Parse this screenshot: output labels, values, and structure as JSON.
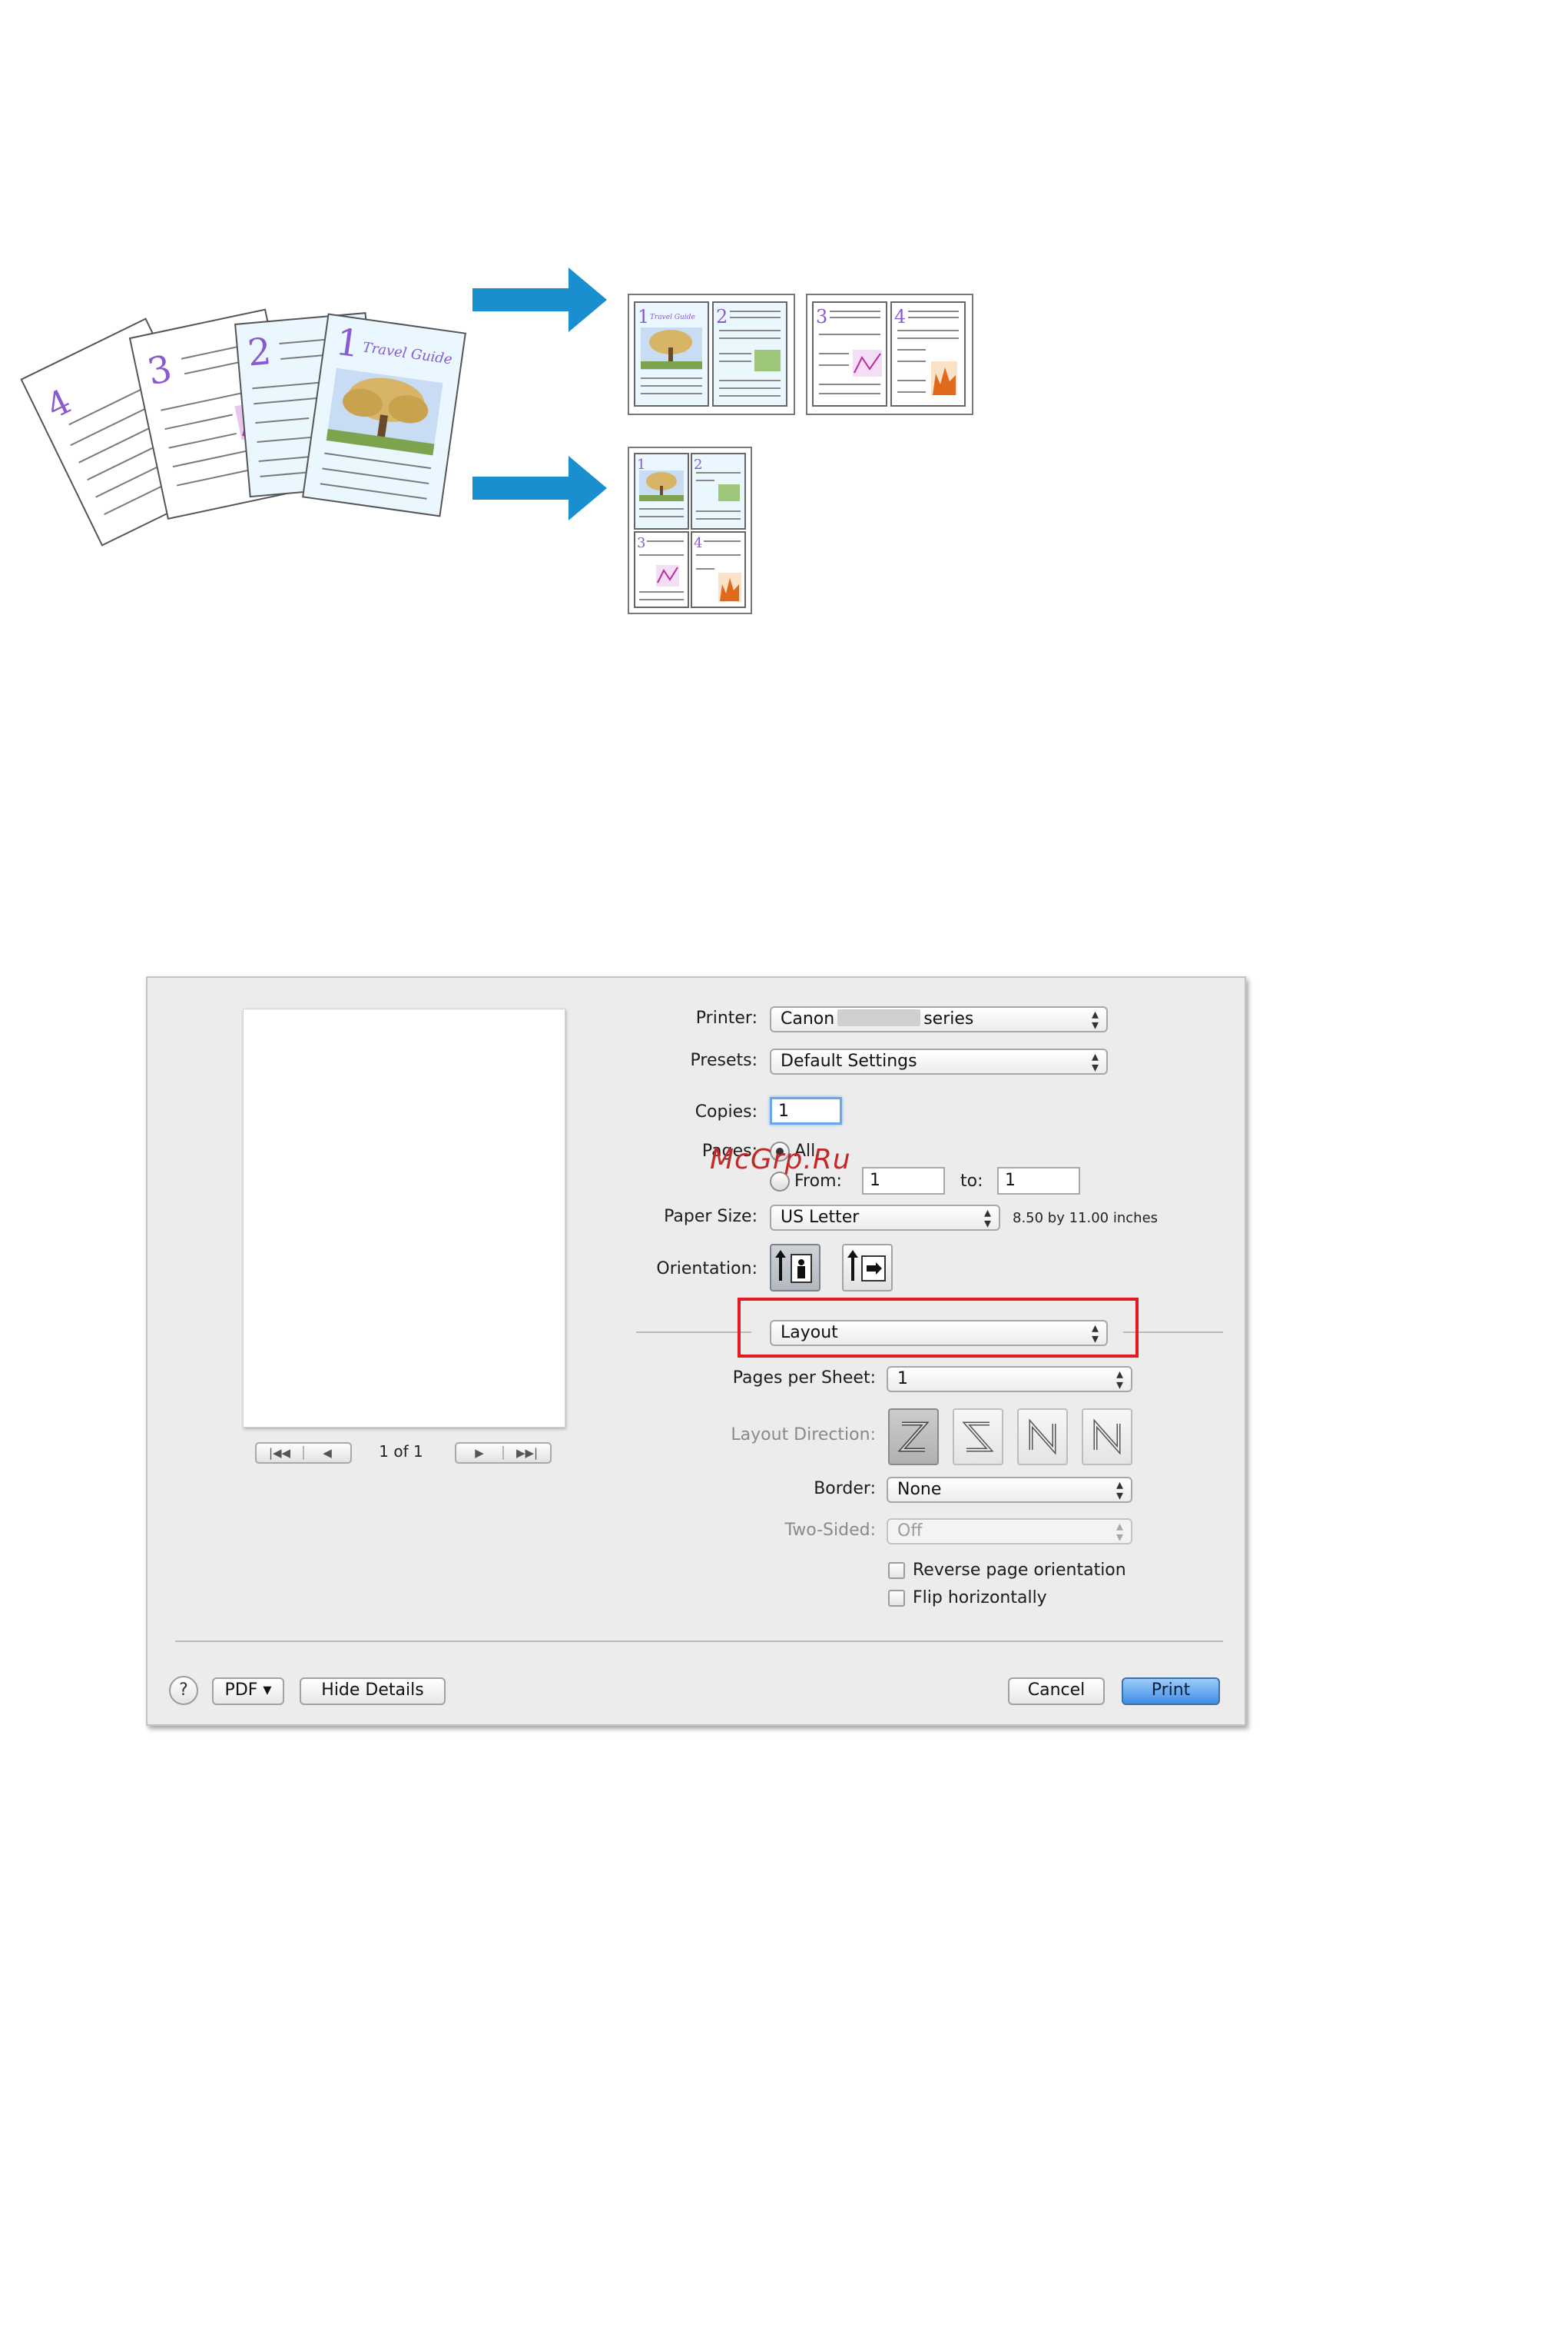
{
  "illustration": {
    "source_pages": [
      {
        "number": "4"
      },
      {
        "number": "3"
      },
      {
        "number": "2"
      },
      {
        "number": "1",
        "title": "Travel Guide"
      }
    ],
    "result_2up": [
      {
        "numbers": [
          "1",
          "2"
        ],
        "title": "Travel Guide"
      },
      {
        "numbers": [
          "3",
          "4"
        ]
      }
    ],
    "result_4up": {
      "numbers": [
        "1",
        "2",
        "3",
        "4"
      ]
    },
    "arrow_color": "#1a8fd0"
  },
  "dialog": {
    "preview": {
      "page_indicator": "1 of 1"
    },
    "printer": {
      "label": "Printer:",
      "value_prefix": "Canon",
      "value_suffix": "series"
    },
    "presets": {
      "label": "Presets:",
      "value": "Default Settings"
    },
    "copies": {
      "label": "Copies:",
      "value": "1"
    },
    "pages": {
      "label": "Pages:",
      "all_label": "All",
      "from_label": "From:",
      "from_value": "1",
      "to_label": "to:",
      "to_value": "1"
    },
    "paper_size": {
      "label": "Paper Size:",
      "value": "US Letter",
      "dimensions": "8.50 by 11.00 inches"
    },
    "orientation": {
      "label": "Orientation:"
    },
    "panel_menu": {
      "value": "Layout"
    },
    "pages_per_sheet": {
      "label": "Pages per Sheet:",
      "value": "1"
    },
    "layout_direction": {
      "label": "Layout Direction:"
    },
    "border": {
      "label": "Border:",
      "value": "None"
    },
    "two_sided": {
      "label": "Two-Sided:",
      "value": "Off"
    },
    "reverse_orientation": {
      "label": "Reverse page orientation"
    },
    "flip_horizontally": {
      "label": "Flip horizontally"
    },
    "buttons": {
      "help": "?",
      "pdf": "PDF ▾",
      "hide_details": "Hide Details",
      "cancel": "Cancel",
      "print": "Print"
    }
  },
  "watermark": "McGrp.Ru",
  "colors": {
    "highlight": "#e21b23",
    "accent": "#3e8ee6"
  }
}
